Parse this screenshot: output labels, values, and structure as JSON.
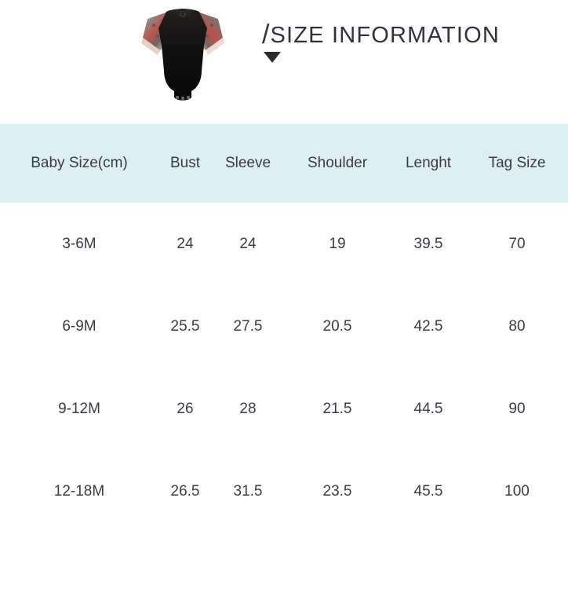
{
  "header": {
    "slash": "/",
    "title": "SIZE INFORMATION",
    "caret_icon": "triangle-down-icon",
    "product_image_alt": "black baby bodysuit with tattoo print mesh sleeves"
  },
  "colors": {
    "header_band": "#ddeef5",
    "text": "#3b3b43",
    "title_text": "#32323a",
    "caret": "#2b2b2b",
    "page_background": "#ffffff"
  },
  "table": {
    "columns": [
      {
        "key": "baby_size",
        "label": "Baby Size(cm)"
      },
      {
        "key": "bust",
        "label": "Bust"
      },
      {
        "key": "sleeve",
        "label": "Sleeve"
      },
      {
        "key": "shoulder",
        "label": "Shoulder"
      },
      {
        "key": "length",
        "label": "Lenght"
      },
      {
        "key": "tag_size",
        "label": "Tag Size"
      }
    ],
    "rows": [
      {
        "baby_size": "3-6M",
        "bust": "24",
        "sleeve": "24",
        "shoulder": "19",
        "length": "39.5",
        "tag_size": "70"
      },
      {
        "baby_size": "6-9M",
        "bust": "25.5",
        "sleeve": "27.5",
        "shoulder": "20.5",
        "length": "42.5",
        "tag_size": "80"
      },
      {
        "baby_size": "9-12M",
        "bust": "26",
        "sleeve": "28",
        "shoulder": "21.5",
        "length": "44.5",
        "tag_size": "90"
      },
      {
        "baby_size": "12-18M",
        "bust": "26.5",
        "sleeve": "31.5",
        "shoulder": "23.5",
        "length": "45.5",
        "tag_size": "100"
      }
    ]
  }
}
